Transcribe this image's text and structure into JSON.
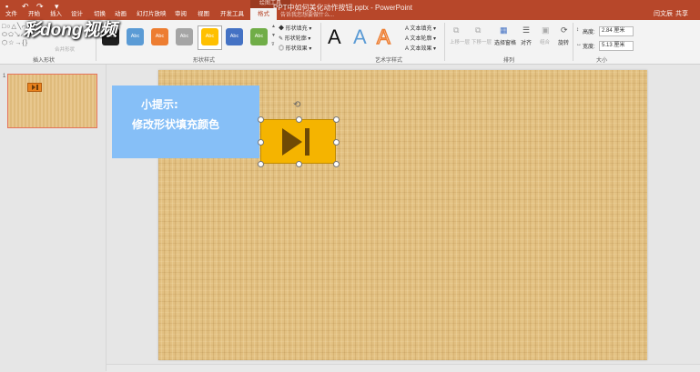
{
  "window": {
    "title": "PPT中如何美化动作按钮.pptx - PowerPoint",
    "context_tab_group": "绘图工具",
    "user": "闫文辰",
    "share": "共享"
  },
  "tabs": [
    {
      "label": "文件"
    },
    {
      "label": "开始"
    },
    {
      "label": "插入"
    },
    {
      "label": "设计"
    },
    {
      "label": "切换"
    },
    {
      "label": "动画"
    },
    {
      "label": "幻灯片放映"
    },
    {
      "label": "审阅"
    },
    {
      "label": "视图"
    },
    {
      "label": "开发工具"
    },
    {
      "label": "格式"
    }
  ],
  "tell_me": "告诉我您想要做什么...",
  "ribbon": {
    "groups": {
      "insert_shapes": "插入形状",
      "shape_styles": "形状样式",
      "wordart_styles": "艺术字样式",
      "arrange": "排列",
      "size": "大小"
    },
    "merge_shapes": "合并形状",
    "style_swatch_label": "Abc",
    "style_colors": [
      "#1f1f1f",
      "#5b9bd5",
      "#ed7d31",
      "#a5a5a5",
      "#ffc000",
      "#4472c4",
      "#70ad47"
    ],
    "shape_fill": "形状填充",
    "shape_outline": "形状轮廓",
    "shape_effects": "形状效果",
    "wordart_letter": "A",
    "text_fill": "文本填充",
    "text_outline": "文本轮廓",
    "text_effects": "文本效果",
    "bring_forward": "上移一层",
    "send_backward": "下移一层",
    "selection_pane": "选择窗格",
    "align": "对齐",
    "group": "组合",
    "rotate": "旋转",
    "height_label": "高度:",
    "height_value": "2.84 厘米",
    "width_label": "宽度:",
    "width_value": "5.13 厘米"
  },
  "watermark": "彩dong视频",
  "slides_pane": {
    "slide_number": "1"
  },
  "slide": {
    "tip_title": "小提示:",
    "tip_body": "修改形状填充颜色",
    "button_fill": "#f5b400"
  }
}
